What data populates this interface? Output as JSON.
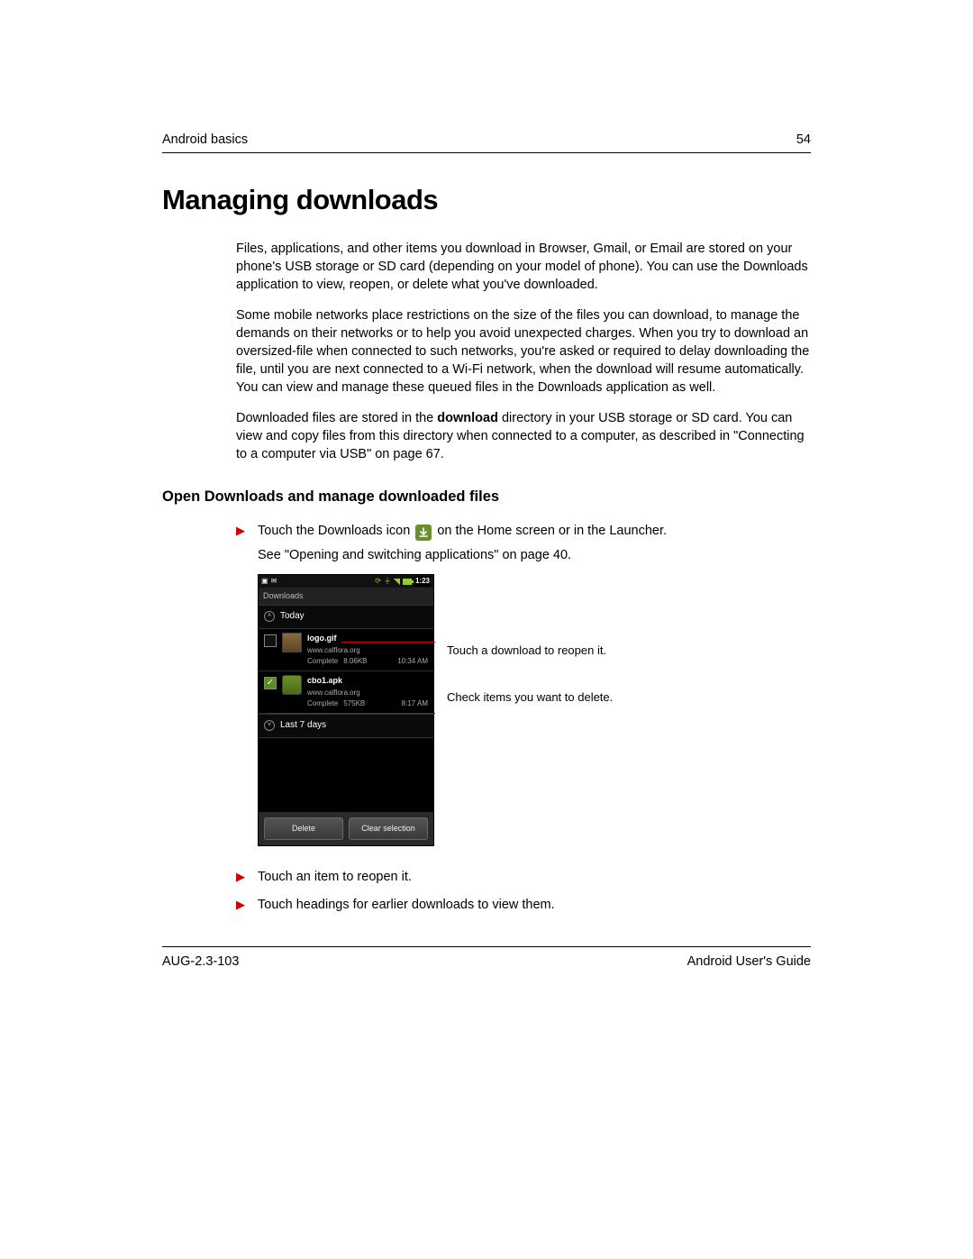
{
  "header": {
    "section": "Android basics",
    "page_number": "54"
  },
  "title": "Managing downloads",
  "paragraphs": {
    "p1": "Files, applications, and other items you download in Browser, Gmail, or Email are stored on your phone's USB storage or SD card (depending on your model of phone). You can use the Downloads application to view, reopen, or delete what you've downloaded.",
    "p2": "Some mobile networks place restrictions on the size of the files you can download, to manage the demands on their networks or to help you avoid unexpected charges. When you try to download an oversized-file when connected to such networks, you're asked or required to delay downloading the file, until you are next connected to a Wi-Fi network, when the download will resume automatically. You can view and manage these queued files in the Downloads application as well.",
    "p3_pre": "Downloaded files are stored in the ",
    "p3_bold": "download",
    "p3_post": " directory in your USB storage or SD card. You can view and copy files from this directory when connected to a computer, as described in \"Connecting to a computer via USB\" on page 67."
  },
  "subhead": "Open Downloads and manage downloaded files",
  "steps": {
    "s1_a": "Touch the Downloads icon ",
    "s1_b": " on the Home screen or in the Launcher.",
    "s1_sub": "See \"Opening and switching applications\" on page 40.",
    "s2": "Touch an item to reopen it.",
    "s3": "Touch headings for earlier downloads to view them."
  },
  "callouts": {
    "c1": "Touch a download to reopen it.",
    "c2": "Check items you want to delete."
  },
  "phone": {
    "time": "1:23",
    "app_title": "Downloads",
    "group_today": "Today",
    "group_last7": "Last 7 days",
    "row1": {
      "name": "logo.gif",
      "src": "www.calflora.org",
      "status": "Complete",
      "size": "8.06KB",
      "time": "10:34 AM"
    },
    "row2": {
      "name": "cbo1.apk",
      "src": "www.calflora.org",
      "status": "Complete",
      "size": "575KB",
      "time": "8:17 AM"
    },
    "btn_delete": "Delete",
    "btn_clear": "Clear selection"
  },
  "footer": {
    "left": "AUG-2.3-103",
    "right": "Android User's Guide"
  }
}
